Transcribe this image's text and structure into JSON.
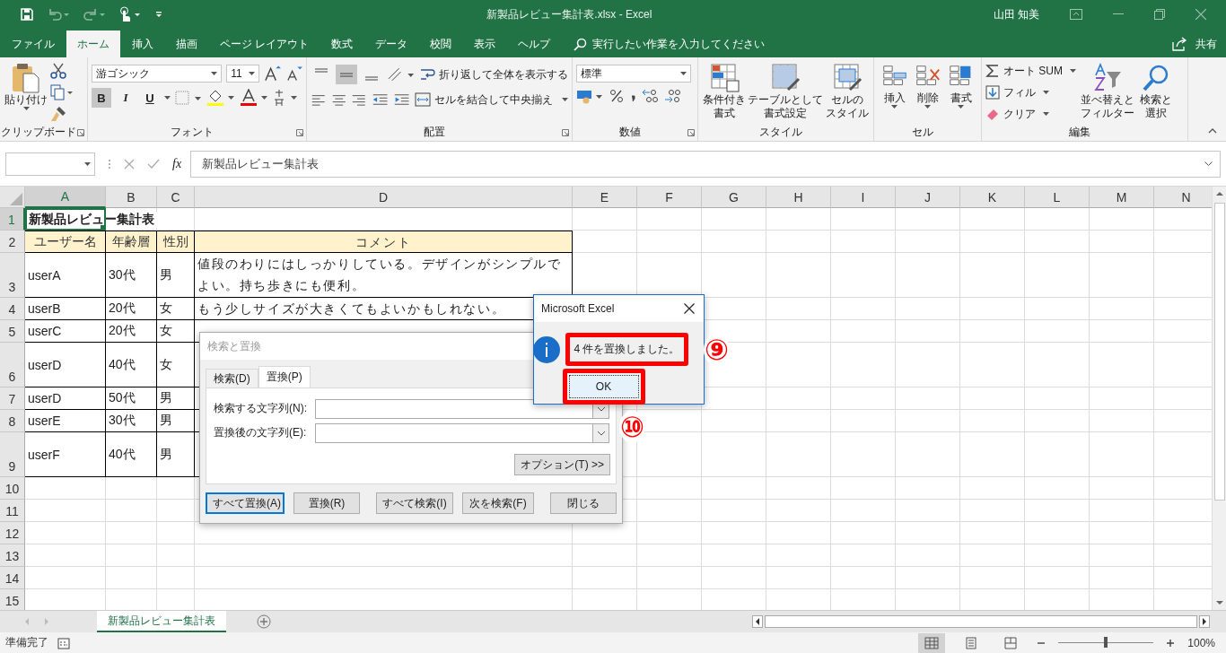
{
  "title_bar": {
    "title": "新製品レビュー集計表.xlsx  -  Excel",
    "user": "山田 知美"
  },
  "tabs": [
    {
      "label": "ファイル",
      "selected": false
    },
    {
      "label": "ホーム",
      "selected": true
    },
    {
      "label": "挿入",
      "selected": false
    },
    {
      "label": "描画",
      "selected": false
    },
    {
      "label": "ページ レイアウト",
      "selected": false
    },
    {
      "label": "数式",
      "selected": false
    },
    {
      "label": "データ",
      "selected": false
    },
    {
      "label": "校閲",
      "selected": false
    },
    {
      "label": "表示",
      "selected": false
    },
    {
      "label": "ヘルプ",
      "selected": false
    }
  ],
  "tell_me": "実行したい作業を入力してください",
  "share": "共有",
  "ribbon": {
    "clipboard": {
      "label": "クリップボード",
      "paste": "貼り付け"
    },
    "font": {
      "label": "フォント",
      "name": "游ゴシック",
      "size": "11",
      "toggles": [
        {
          "label": "B",
          "on": true
        },
        {
          "label": "I",
          "on": false
        },
        {
          "label": "U",
          "on": false
        }
      ]
    },
    "alignment": {
      "label": "配置",
      "valign": [
        {
          "on": false
        },
        {
          "on": true
        },
        {
          "on": false
        }
      ],
      "wrap": "折り返して全体を表示する",
      "merge": "セルを結合して中央揃え"
    },
    "number": {
      "label": "数値",
      "format": "標準"
    },
    "styles": {
      "label": "スタイル",
      "buttons": [
        {
          "lines": [
            "条件付き",
            "書式"
          ]
        },
        {
          "lines": [
            "テーブルとして",
            "書式設定"
          ]
        },
        {
          "lines": [
            "セルの",
            "スタイル"
          ]
        }
      ]
    },
    "cells": {
      "label": "セル",
      "buttons": [
        {
          "lines": [
            "挿入"
          ]
        },
        {
          "lines": [
            "削除"
          ]
        },
        {
          "lines": [
            "書式"
          ]
        }
      ]
    },
    "editing": {
      "label": "編集",
      "small": [
        "オート SUM",
        "フィル",
        "クリア"
      ],
      "buttons": [
        {
          "lines": [
            "並べ替えと",
            "フィルター"
          ]
        },
        {
          "lines": [
            "検索と",
            "選択"
          ]
        }
      ]
    }
  },
  "formula_bar": {
    "fx": "fx",
    "formula": "新製品レビュー集計表"
  },
  "grid": {
    "columns": [
      {
        "label": "A",
        "selected": true
      },
      {
        "label": "B",
        "selected": false
      },
      {
        "label": "C",
        "selected": false
      },
      {
        "label": "D",
        "selected": false
      },
      {
        "label": "E",
        "selected": false
      },
      {
        "label": "F",
        "selected": false
      },
      {
        "label": "G",
        "selected": false
      },
      {
        "label": "H",
        "selected": false
      },
      {
        "label": "I",
        "selected": false
      },
      {
        "label": "J",
        "selected": false
      },
      {
        "label": "K",
        "selected": false
      },
      {
        "label": "L",
        "selected": false
      },
      {
        "label": "M",
        "selected": false
      },
      {
        "label": "N",
        "selected": false
      }
    ],
    "rows": [
      {
        "num": "1",
        "selected": true,
        "kind": "title",
        "cells": {
          "A": "新製品レビュー集計表"
        }
      },
      {
        "num": "2",
        "selected": false,
        "kind": "header",
        "cells": {
          "A": "ユーザー名",
          "B": "年齢層",
          "C": "性別",
          "D": "コメント"
        }
      },
      {
        "num": "3",
        "selected": false,
        "kind": "tall",
        "cells": {
          "A": "userA",
          "B": "30代",
          "C": "男",
          "D": "値段のわりにはしっかりしている。デザインがシンプルでよい。持ち歩きにも便利。"
        }
      },
      {
        "num": "4",
        "selected": false,
        "kind": "data",
        "cells": {
          "A": "userB",
          "B": "20代",
          "C": "女",
          "D": "もう少しサイズが大きくてもよいかもしれない。"
        }
      },
      {
        "num": "5",
        "selected": false,
        "kind": "data",
        "cells": {
          "A": "userC",
          "B": "20代",
          "C": "女"
        }
      },
      {
        "num": "6",
        "selected": false,
        "kind": "tall",
        "cells": {
          "A": "userD",
          "B": "40代",
          "C": "女"
        }
      },
      {
        "num": "7",
        "selected": false,
        "kind": "data",
        "cells": {
          "A": "userD",
          "B": "50代",
          "C": "男"
        }
      },
      {
        "num": "8",
        "selected": false,
        "kind": "data",
        "cells": {
          "A": "userE",
          "B": "30代",
          "C": "男"
        }
      },
      {
        "num": "9",
        "selected": false,
        "kind": "tall",
        "cells": {
          "A": "userF",
          "B": "40代",
          "C": "男"
        }
      },
      {
        "num": "10",
        "selected": false,
        "kind": "empty"
      },
      {
        "num": "11",
        "selected": false,
        "kind": "empty"
      },
      {
        "num": "12",
        "selected": false,
        "kind": "empty"
      },
      {
        "num": "13",
        "selected": false,
        "kind": "empty"
      },
      {
        "num": "14",
        "selected": false,
        "kind": "empty"
      },
      {
        "num": "15",
        "selected": false,
        "kind": "empty"
      }
    ]
  },
  "sheet_tabs": [
    {
      "label": "新製品レビュー集計表",
      "selected": true
    }
  ],
  "status_bar": {
    "text": "準備完了",
    "zoom": "100%",
    "zoom_level": {
      "level": 0.5
    }
  },
  "find_dialog": {
    "title": "検索と置換",
    "tabs": [
      {
        "label": "検索(D)",
        "selected": false
      },
      {
        "label": "置換(P)",
        "selected": true
      }
    ],
    "fields": [
      {
        "label": "検索する文字列(N):"
      },
      {
        "label": "置換後の文字列(E):"
      }
    ],
    "options": "オプション(T) >>",
    "buttons": [
      {
        "label": "すべて置換(A)",
        "default": true
      },
      {
        "label": "置換(R)",
        "default": false
      },
      {
        "label": "すべて検索(I)",
        "default": false
      },
      {
        "label": "次を検索(F)",
        "default": false
      },
      {
        "label": "閉じる",
        "default": false
      }
    ]
  },
  "message_box": {
    "title": "Microsoft Excel",
    "message": "4 件を置換しました。",
    "ok": "OK"
  },
  "annotations": [
    {
      "label": "⑨"
    },
    {
      "label": "⑩"
    }
  ]
}
